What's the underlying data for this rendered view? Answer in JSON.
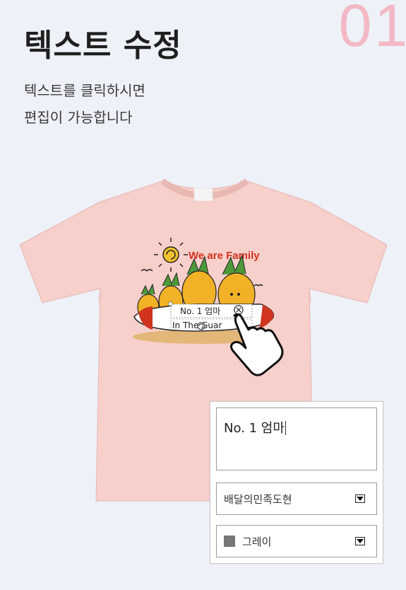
{
  "header": {
    "title": "텍스트 수정",
    "step_number": "01",
    "description_line1": "텍스트를 클릭하시면",
    "description_line2": "편집이 가능합니다"
  },
  "design": {
    "headline": "We are Family",
    "line1": "No. 1 엄마",
    "line2": "In The Guar"
  },
  "editor": {
    "text_value": "No. 1 엄마",
    "font_selected": "배달의민족도현",
    "color_selected": "그레이",
    "color_swatch": "#777777"
  },
  "colors": {
    "background": "#eef1f8",
    "shirt": "#f7cfcb",
    "accent_number": "#f2b8c4",
    "headline_red": "#d0341f"
  }
}
